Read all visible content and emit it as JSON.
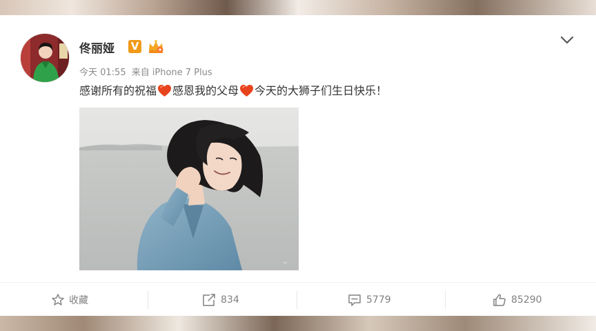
{
  "post": {
    "user_name": "佟丽娅",
    "verified_badge": "V",
    "time": "今天 01:55",
    "source_prefix": "来自",
    "source_device": "iPhone 7 Plus",
    "text_part1": "感谢所有的祝福",
    "text_part2": "感恩我的父母",
    "text_part3": "今天的大狮子们生日快乐！"
  },
  "actions": {
    "favorite_label": "收藏",
    "repost_count": "834",
    "comment_count": "5779",
    "like_count": "85290"
  },
  "icons": {
    "more": "chevron-down-icon",
    "favorite": "star-icon",
    "repost": "share-icon",
    "comment": "comment-icon",
    "like": "thumbs-up-icon",
    "emoji": "heart-icon"
  },
  "colors": {
    "verified": "#f09a1a",
    "heart": "#e8431c",
    "text": "#333333",
    "muted": "#808080"
  }
}
